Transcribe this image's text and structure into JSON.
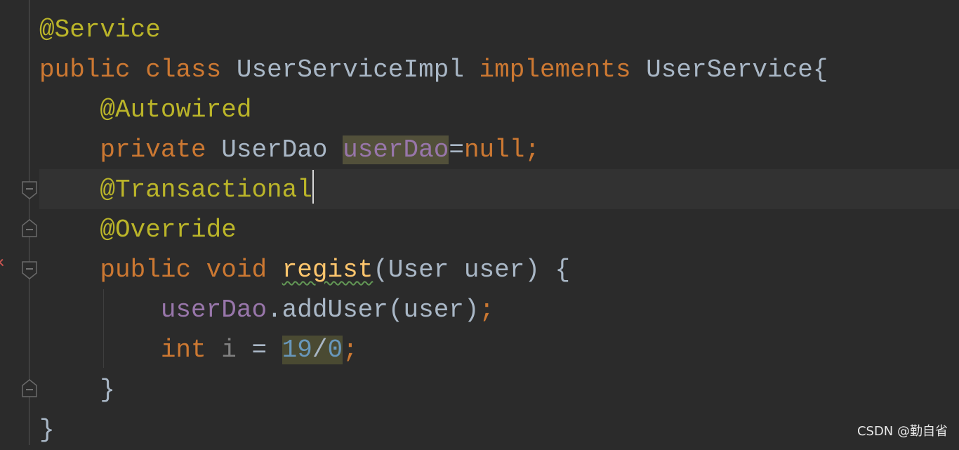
{
  "editor": {
    "lines": [
      {
        "tokens": [
          {
            "t": "@Service",
            "c": "ann"
          }
        ]
      },
      {
        "tokens": [
          {
            "t": "public",
            "c": "kw"
          },
          {
            "t": " ",
            "c": "plain"
          },
          {
            "t": "class",
            "c": "kw"
          },
          {
            "t": " UserServiceImpl ",
            "c": "plain"
          },
          {
            "t": "implements",
            "c": "kw"
          },
          {
            "t": " UserService{",
            "c": "plain"
          }
        ]
      },
      {
        "tokens": [
          {
            "t": "    ",
            "c": "plain"
          },
          {
            "t": "@Autowired",
            "c": "ann"
          }
        ]
      },
      {
        "tokens": [
          {
            "t": "    ",
            "c": "plain"
          },
          {
            "t": "private",
            "c": "kw"
          },
          {
            "t": " UserDao ",
            "c": "plain"
          },
          {
            "t": "userDao",
            "c": "field hl-usage"
          },
          {
            "t": "=",
            "c": "plain"
          },
          {
            "t": "null",
            "c": "kw"
          },
          {
            "t": ";",
            "c": "kw"
          }
        ]
      },
      {
        "tokens": [
          {
            "t": "    ",
            "c": "plain"
          },
          {
            "t": "@Transactional",
            "c": "ann"
          }
        ],
        "caret": true
      },
      {
        "tokens": [
          {
            "t": "    ",
            "c": "plain"
          },
          {
            "t": "@Override",
            "c": "ann"
          }
        ]
      },
      {
        "tokens": [
          {
            "t": "    ",
            "c": "plain"
          },
          {
            "t": "public",
            "c": "kw"
          },
          {
            "t": " ",
            "c": "plain"
          },
          {
            "t": "void",
            "c": "kw"
          },
          {
            "t": " ",
            "c": "plain"
          },
          {
            "t": "regist",
            "c": "fn"
          },
          {
            "t": "(User user) {",
            "c": "plain"
          }
        ]
      },
      {
        "tokens": [
          {
            "t": "        ",
            "c": "plain"
          },
          {
            "t": "userDao",
            "c": "field"
          },
          {
            "t": ".addUser(user)",
            "c": "plain"
          },
          {
            "t": ";",
            "c": "kw"
          }
        ]
      },
      {
        "tokens": [
          {
            "t": "        ",
            "c": "plain"
          },
          {
            "t": "int",
            "c": "kw"
          },
          {
            "t": " ",
            "c": "plain"
          },
          {
            "t": "i",
            "c": "unused"
          },
          {
            "t": " = ",
            "c": "plain"
          },
          {
            "t": "19",
            "c": "num hl-usage2"
          },
          {
            "t": "/",
            "c": "plain hl-usage2"
          },
          {
            "t": "0",
            "c": "num hl-usage2"
          },
          {
            "t": ";",
            "c": "kw"
          }
        ]
      },
      {
        "tokens": [
          {
            "t": "    }",
            "c": "plain"
          }
        ]
      },
      {
        "tokens": [
          {
            "t": "}",
            "c": "plain"
          }
        ]
      }
    ]
  },
  "colors": {
    "background": "#2b2b2b",
    "annotation": "#bbb529",
    "keyword": "#cc7832",
    "field": "#9876aa",
    "method": "#ffc66d",
    "number": "#6897bb"
  },
  "gutter": {
    "fold_icons": [
      "fold-end-icon",
      "fold-start-icon",
      "fold-start-icon",
      "fold-end-icon"
    ]
  },
  "watermark": {
    "text": "CSDN @勤自省"
  }
}
